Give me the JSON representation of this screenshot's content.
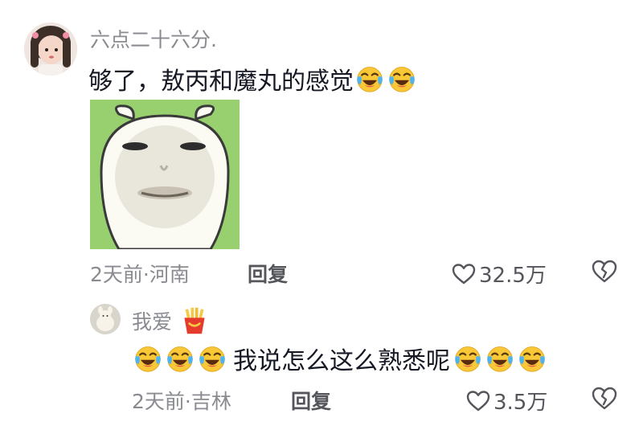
{
  "comment": {
    "username": "六点二十六分.",
    "text": "够了，敖丙和魔丸的感觉",
    "text_emojis": [
      "crying-laughing",
      "crying-laughing"
    ],
    "time_location": "2天前·河南",
    "reply_label": "回复",
    "like_count": "32.5万"
  },
  "reply": {
    "username": "我爱",
    "username_emoji": "fries",
    "text": "我说怎么这么熟悉呢",
    "leading_emojis": [
      "crying-laughing",
      "crying-laughing",
      "crying-laughing"
    ],
    "trailing_emojis": [
      "crying-laughing",
      "crying-laughing",
      "crying-laughing"
    ],
    "time_location": "2天前·吉林",
    "reply_label": "回复",
    "like_count": "3.5万"
  },
  "colors": {
    "primary_text": "#161823",
    "secondary_text": "#8a8b91",
    "sticker_bg": "#98cf6f"
  }
}
